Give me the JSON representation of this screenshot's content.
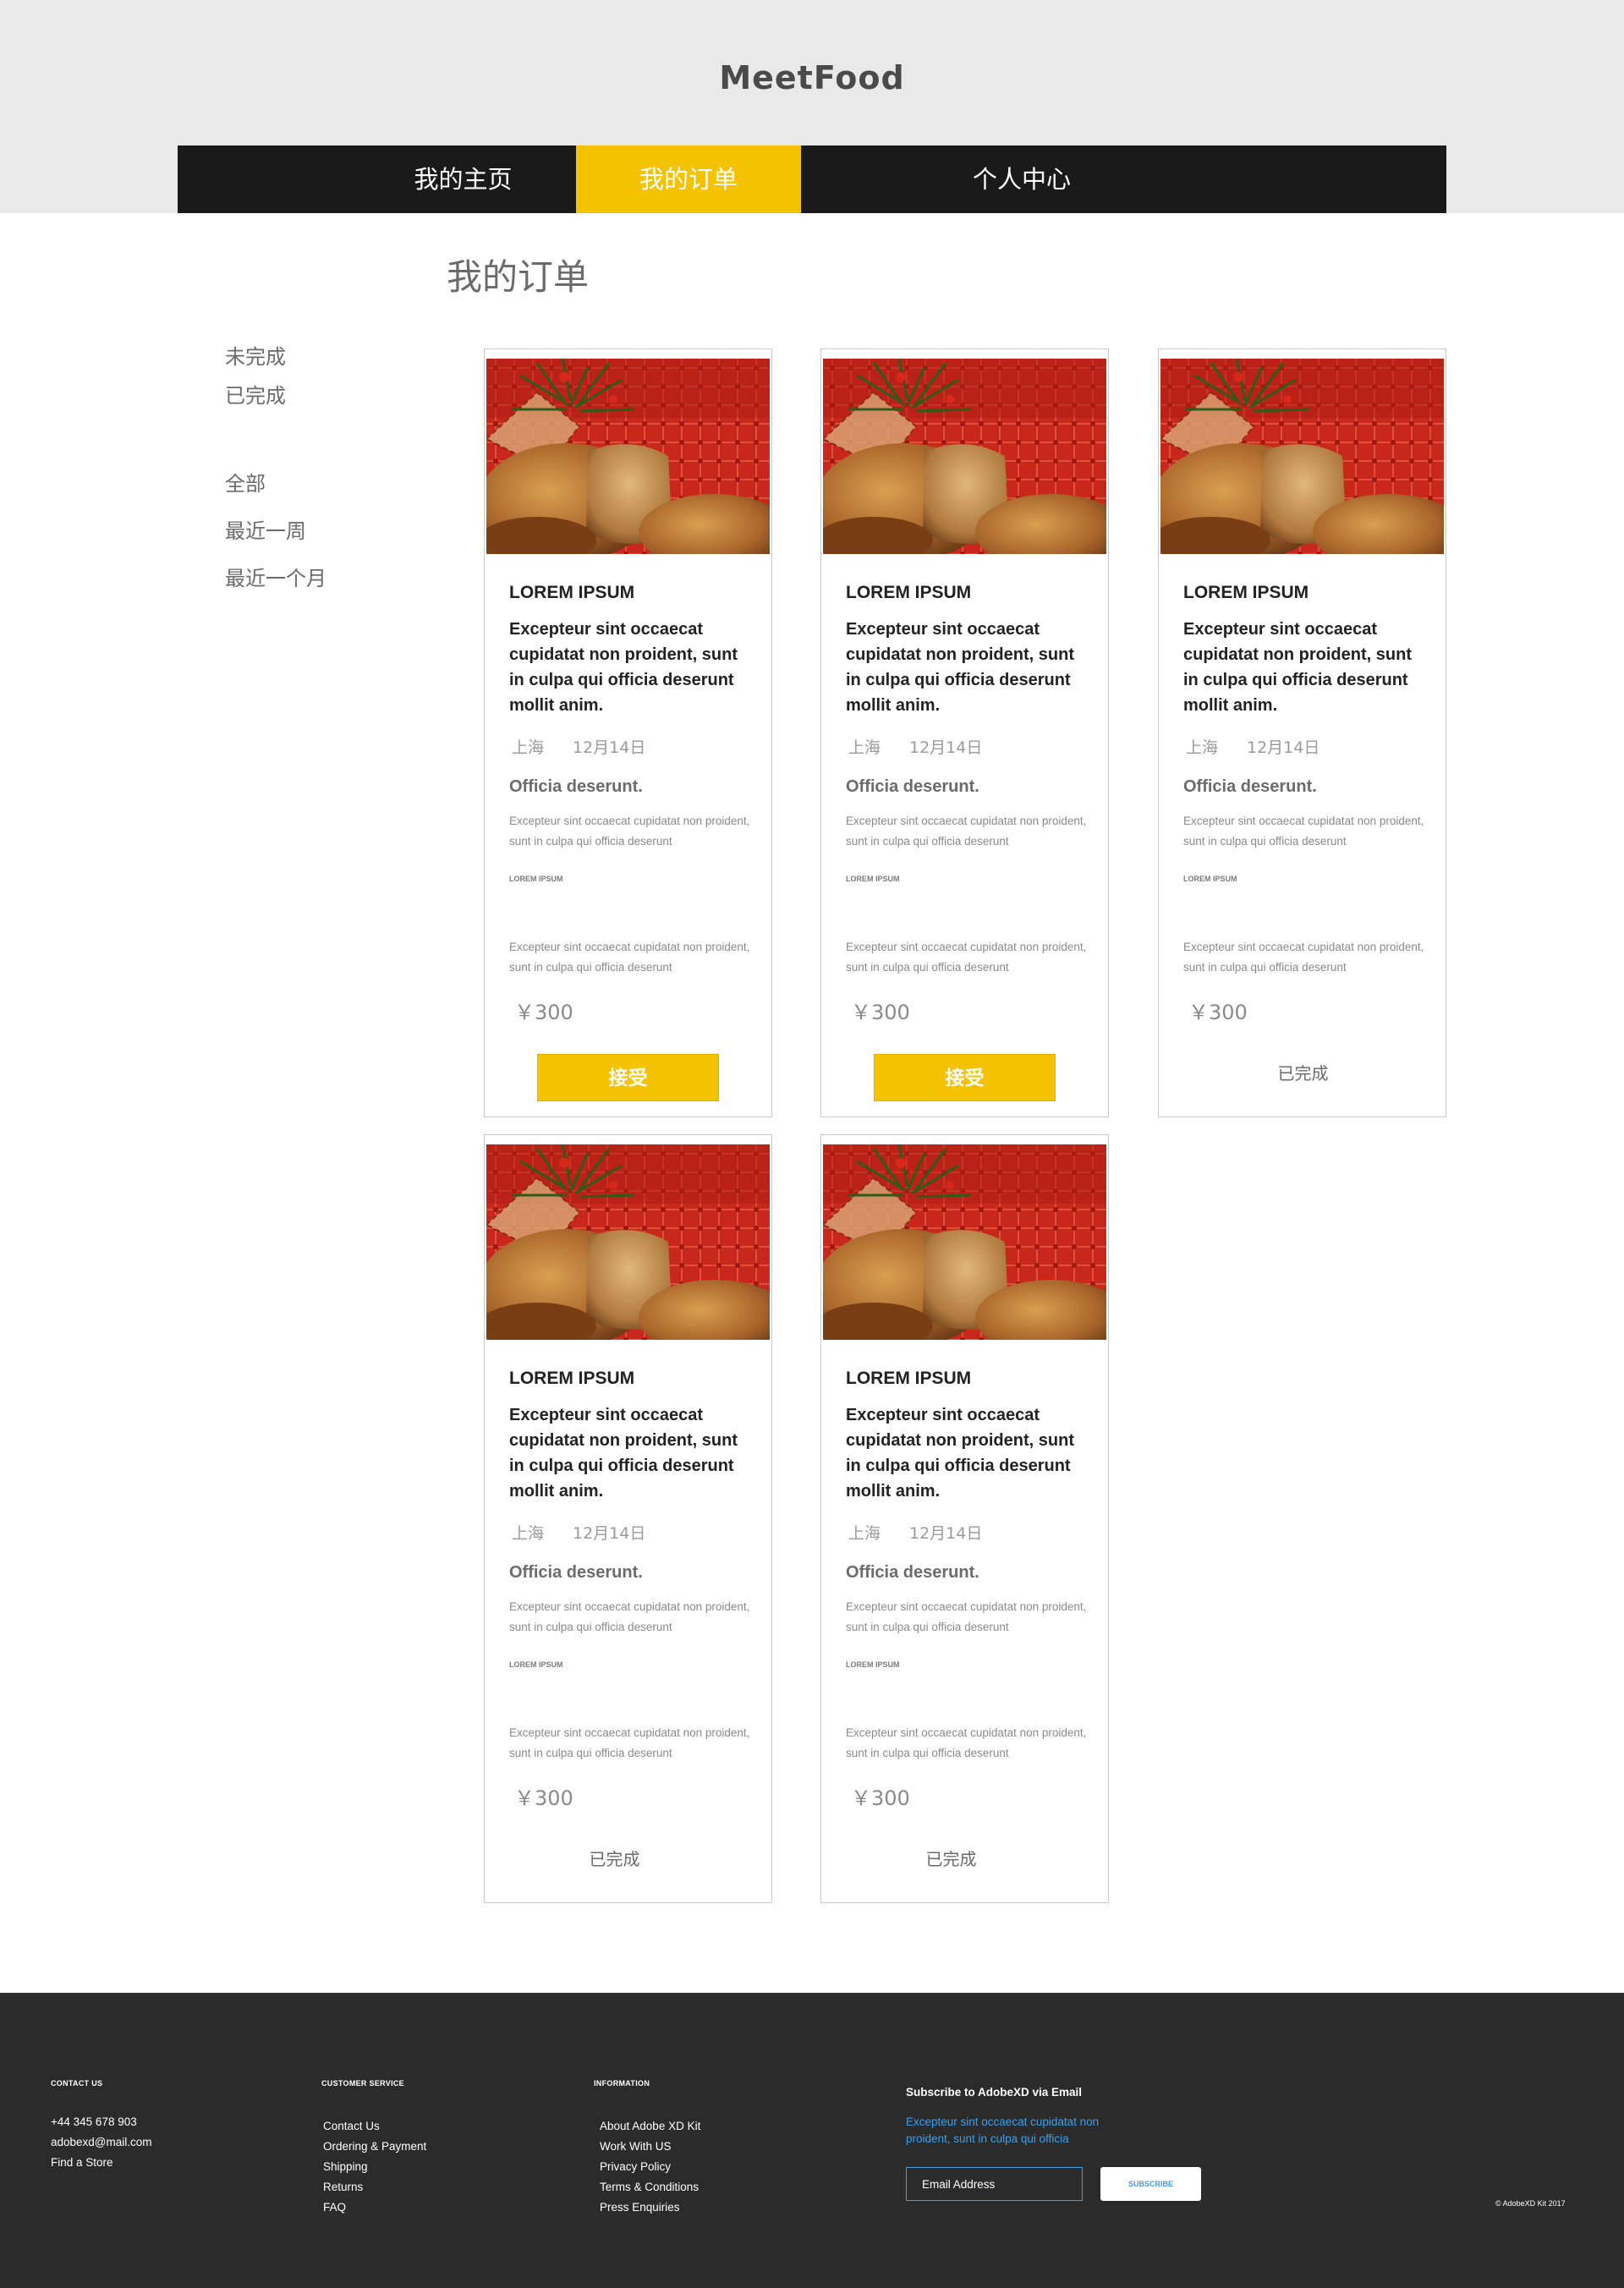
{
  "app": {
    "logo": "MeetFood"
  },
  "nav": {
    "items": [
      {
        "label": "我的主页"
      },
      {
        "label": "我的订单"
      },
      {
        "label": "个人中心"
      }
    ],
    "active_index": 1
  },
  "main": {
    "title": "我的订单",
    "status_filters": [
      "未完成",
      "已完成"
    ],
    "time_filters": [
      "全部",
      "最近一周",
      "最近一个月"
    ]
  },
  "colors": {
    "accent": "#f5c200",
    "nav_bg": "#1a1a1a",
    "header_bg": "#e9e9e9",
    "footer_bg": "#2b2b2b",
    "link_blue": "#3f9eea"
  },
  "orders": [
    {
      "heading": "LOREM IPSUM",
      "description": "Excepteur sint occaecat cupidatat non proident, sunt in culpa qui officia deserunt mollit anim.",
      "city": "上海",
      "date": "12月14日",
      "subtitle": "Officia deserunt.",
      "body1": "Excepteur sint occaecat cupidatat non proident, sunt in culpa qui officia deserunt",
      "tag": "LOREM IPSUM",
      "body2": "Excepteur sint occaecat cupidatat non proident, sunt in culpa qui officia deserunt",
      "price": "￥300",
      "action": "接受"
    },
    {
      "heading": "LOREM IPSUM",
      "description": "Excepteur sint occaecat cupidatat non proident, sunt in culpa qui officia deserunt mollit anim.",
      "city": "上海",
      "date": "12月14日",
      "subtitle": "Officia deserunt.",
      "body1": "Excepteur sint occaecat cupidatat non proident, sunt in culpa qui officia deserunt",
      "tag": "LOREM IPSUM",
      "body2": "Excepteur sint occaecat cupidatat non proident, sunt in culpa qui officia deserunt",
      "price": "￥300",
      "action": "接受"
    },
    {
      "heading": "LOREM IPSUM",
      "description": "Excepteur sint occaecat cupidatat non proident, sunt in culpa qui officia deserunt mollit anim.",
      "city": "上海",
      "date": "12月14日",
      "subtitle": "Officia deserunt.",
      "body1": "Excepteur sint occaecat cupidatat non proident, sunt in culpa qui officia deserunt",
      "tag": "LOREM IPSUM",
      "body2": "Excepteur sint occaecat cupidatat non proident, sunt in culpa qui officia deserunt",
      "price": "￥300",
      "status": "已完成"
    },
    {
      "heading": "LOREM IPSUM",
      "description": "Excepteur sint occaecat cupidatat non proident, sunt in culpa qui officia deserunt mollit anim.",
      "city": "上海",
      "date": "12月14日",
      "subtitle": "Officia deserunt.",
      "body1": "Excepteur sint occaecat cupidatat non proident, sunt in culpa qui officia deserunt",
      "tag": "LOREM IPSUM",
      "body2": "Excepteur sint occaecat cupidatat non proident, sunt in culpa qui officia deserunt",
      "price": "￥300",
      "status": "已完成"
    },
    {
      "heading": "LOREM IPSUM",
      "description": "Excepteur sint occaecat cupidatat non proident, sunt in culpa qui officia deserunt mollit anim.",
      "city": "上海",
      "date": "12月14日",
      "subtitle": "Officia deserunt.",
      "body1": "Excepteur sint occaecat cupidatat non proident, sunt in culpa qui officia deserunt",
      "tag": "LOREM IPSUM",
      "body2": "Excepteur sint occaecat cupidatat non proident, sunt in culpa qui officia deserunt",
      "price": "￥300",
      "status": "已完成"
    }
  ],
  "footer": {
    "contact": {
      "title": "CONTACT US",
      "items": [
        "+44 345 678 903",
        "adobexd@mail.com",
        "Find a Store"
      ]
    },
    "service": {
      "title": "CUSTOMER SERVICE",
      "items": [
        "Contact Us",
        "Ordering & Payment",
        "Shipping",
        "Returns",
        "FAQ"
      ]
    },
    "info": {
      "title": "INFORMATION",
      "items": [
        "About Adobe XD Kit",
        "Work With US",
        "Privacy Policy",
        "Terms & Conditions",
        "Press Enquiries"
      ]
    },
    "subscribe": {
      "title": "Subscribe to AdobeXD via Email",
      "text": "Excepteur sint occaecat cupidatat non proident, sunt in culpa qui officia",
      "placeholder": "Email Address",
      "button": "SUBSCRIBE"
    },
    "copyright": "© AdobeXD Kit 2017"
  }
}
